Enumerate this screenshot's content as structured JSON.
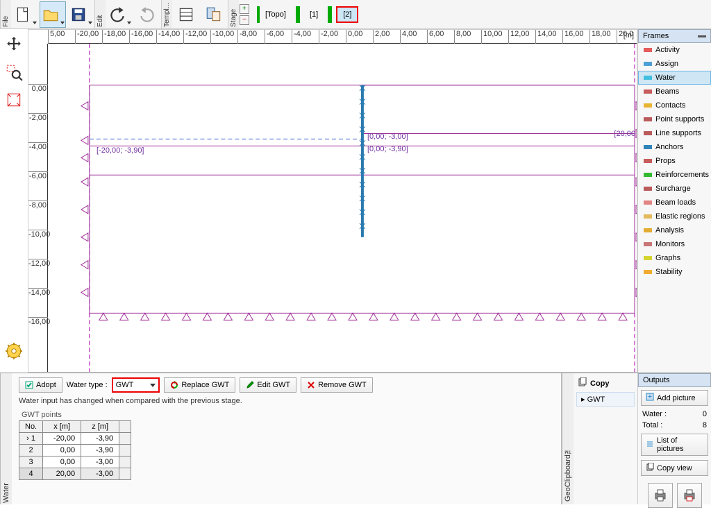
{
  "toolbar": {
    "file_label": "File",
    "edit_label": "Edit",
    "templ_label": "Templ...",
    "stage_label": "Stage",
    "stages": {
      "topo": "[Topo]",
      "s1": "[1]",
      "s2": "[2]"
    }
  },
  "ruler": {
    "x_ticks": [
      "5,00",
      "-20,00",
      "-18,00",
      "-16,00",
      "-14,00",
      "-12,00",
      "-10,00",
      "-8,00",
      "-6,00",
      "-4,00",
      "-2,00",
      "0,00",
      "2,00",
      "4,00",
      "6,00",
      "8,00",
      "10,00",
      "12,00",
      "14,00",
      "16,00",
      "18,00",
      "20,0"
    ],
    "x_unit": "[m]",
    "y_ticks": [
      "0,00",
      "-2,00",
      "-4,00",
      "-6,00",
      "-8,00",
      "-10,00",
      "-12,00",
      "-14,00",
      "-16,00"
    ]
  },
  "drawing_labels": {
    "left_pt": "[-20,00; -3,90]",
    "mid_top": "[0,00; -3,00]",
    "mid_bot": "[0,00; -3,90]",
    "right_pt": "[20,00"
  },
  "frames": {
    "title": "Frames",
    "items": [
      "Activity",
      "Assign",
      "Water",
      "Beams",
      "Contacts",
      "Point supports",
      "Line supports",
      "Anchors",
      "Props",
      "Reinforcements",
      "Surcharge",
      "Beam loads",
      "Elastic regions",
      "Analysis",
      "Monitors",
      "Graphs",
      "Stability"
    ],
    "active_index": 2
  },
  "bottom": {
    "water_tab": "Water",
    "adopt": "Adopt",
    "water_type_label": "Water type :",
    "water_type_value": "GWT",
    "replace": "Replace GWT",
    "edit": "Edit GWT",
    "remove": "Remove GWT",
    "changed_msg": "Water input has changed when compared with the previous stage.",
    "gwt_points_title": "GWT points",
    "headers": {
      "no": "No.",
      "x": "x [m]",
      "z": "z [m]"
    },
    "rows": [
      {
        "no": "1",
        "x": "-20,00",
        "z": "-3,90"
      },
      {
        "no": "2",
        "x": "0,00",
        "z": "-3,90"
      },
      {
        "no": "3",
        "x": "0,00",
        "z": "-3,00"
      },
      {
        "no": "4",
        "x": "20,00",
        "z": "-3,00"
      }
    ]
  },
  "clipboard": {
    "tab": "GeoClipboard™",
    "copy_title": "Copy",
    "item_gwt": "GWT",
    "arrow": "▸"
  },
  "outputs": {
    "title": "Outputs",
    "add_picture": "Add picture",
    "water_label": "Water :",
    "water_count": "0",
    "total_label": "Total :",
    "total_count": "8",
    "list_pictures": "List of pictures",
    "copy_view": "Copy view"
  },
  "icon_colors": {
    "activity": "#d33",
    "assign": "#28c",
    "water": "#1bb5d8",
    "beams": "#b33",
    "contacts": "#e5a100",
    "point": "#a33",
    "line": "#a33",
    "anchors": "#06a",
    "props": "#b33",
    "reinf": "#0a0",
    "surcharge": "#a33",
    "beamloads": "#d66",
    "elastic": "#da3",
    "analysis": "#d90",
    "monitors": "#b55",
    "graphs": "#cc0",
    "stability": "#e90"
  }
}
